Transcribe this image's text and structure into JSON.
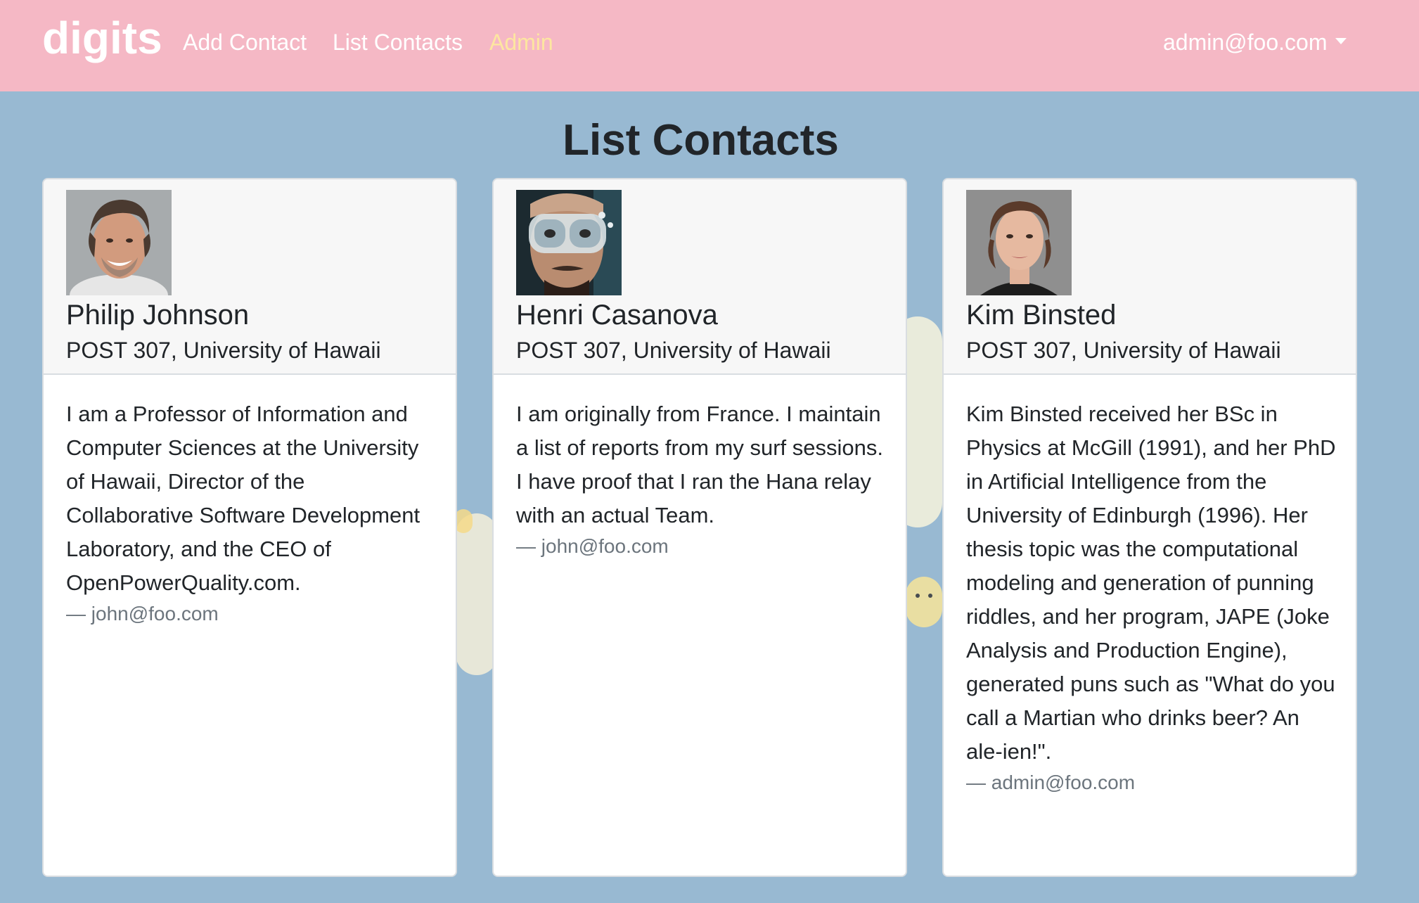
{
  "navbar": {
    "brand": "digits",
    "links": {
      "add_contact": "Add Contact",
      "list_contacts": "List Contacts",
      "admin": "Admin"
    },
    "user": "admin@foo.com"
  },
  "page": {
    "title": "List Contacts"
  },
  "contacts": [
    {
      "name": "Philip Johnson",
      "address": "POST 307, University of Hawaii",
      "description": "I am a Professor of Information and Computer Sciences at the University of Hawaii, Director of the Collaborative Software Development Laboratory, and the CEO of OpenPowerQuality.com.",
      "owner": "— john@foo.com"
    },
    {
      "name": "Henri Casanova",
      "address": "POST 307, University of Hawaii",
      "description": "I am originally from France. I maintain a list of reports from my surf sessions. I have proof that I ran the Hana relay with an actual Team.",
      "owner": "— john@foo.com"
    },
    {
      "name": "Kim Binsted",
      "address": "POST 307, University of Hawaii",
      "description": "Kim Binsted received her BSc in Physics at McGill (1991), and her PhD in Artificial Intelligence from the University of Edinburgh (1996). Her thesis topic was the computational modeling and generation of punning riddles, and her program, JAPE (Joke Analysis and Production Engine), generated puns such as \"What do you call a Martian who drinks beer? An ale-ien!\".",
      "owner": "— admin@foo.com"
    }
  ],
  "colors": {
    "navbar_bg": "#f5b8c5",
    "page_bg": "#98b9d2",
    "admin_link": "#fde6a0",
    "owner_text": "#6c757d"
  }
}
